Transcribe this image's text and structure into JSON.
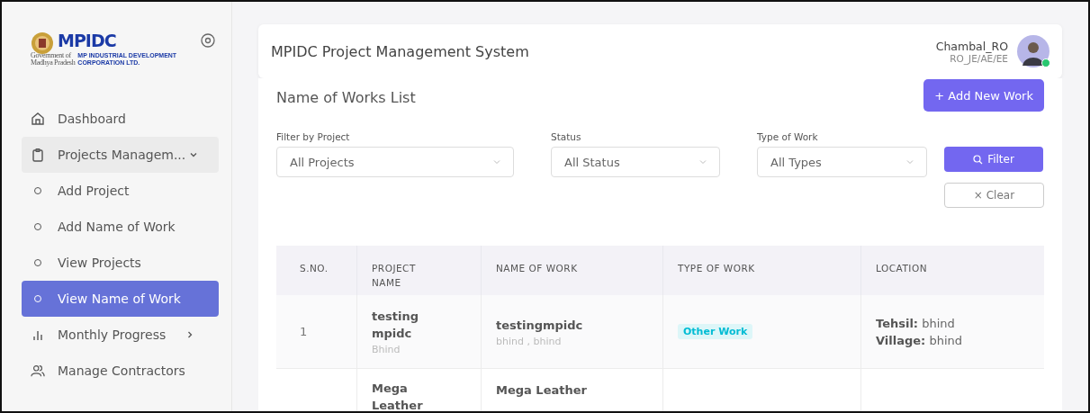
{
  "logo": {
    "mark": "MPIDC",
    "gov_line_1": "Government of",
    "gov_line_2": "Madhya Pradesh",
    "name_line_1": "MP INDUSTRIAL DEVELOPMENT",
    "name_line_2": "CORPORATION LTD."
  },
  "sidebar": {
    "items": [
      {
        "kind": "link",
        "label": "Dashboard",
        "selected": false
      },
      {
        "kind": "group",
        "label": "Projects Managem...",
        "expanded": true,
        "selected": false
      },
      {
        "kind": "sub",
        "label": "Add Project",
        "selected": false
      },
      {
        "kind": "sub",
        "label": "Add Name of Work",
        "selected": false
      },
      {
        "kind": "sub",
        "label": "View Projects",
        "selected": false
      },
      {
        "kind": "sub",
        "label": "View Name of Work",
        "selected": true
      },
      {
        "kind": "group",
        "label": "Monthly Progress",
        "expanded": false,
        "selected": false
      },
      {
        "kind": "link",
        "label": "Manage Contractors",
        "selected": false
      }
    ]
  },
  "header": {
    "title": "MPIDC Project Management System",
    "user_name": "Chambal_RO",
    "user_role": "RO_JE/AE/EE",
    "online": true
  },
  "page": {
    "title": "Name of Works List",
    "add_button": "+ Add New Work"
  },
  "filters": [
    {
      "label": "Filter by Project",
      "value": "All Projects"
    },
    {
      "label": "Status",
      "value": "All Status"
    },
    {
      "label": "Type of Work",
      "value": "All Types"
    }
  ],
  "filter_button": "Filter",
  "clear_button": "× Clear",
  "table": {
    "columns": [
      "S.NO.",
      "PROJECT NAME",
      "NAME OF WORK",
      "TYPE OF WORK",
      "LOCATION"
    ],
    "rows": [
      {
        "sno": "1",
        "project": "testing mpidc",
        "project_sub": "Bhind",
        "work": "testingmpidc",
        "work_sub": "bhind , bhind",
        "type": "Other Work",
        "location": [
          {
            "label": "Tehsil:",
            "value": "bhind"
          },
          {
            "label": "Village:",
            "value": "bhind"
          }
        ]
      },
      {
        "sno": "",
        "project": "Mega Leather",
        "project_sub": "",
        "work": "Mega Leather",
        "work_sub": "",
        "type": "",
        "location": []
      }
    ]
  }
}
